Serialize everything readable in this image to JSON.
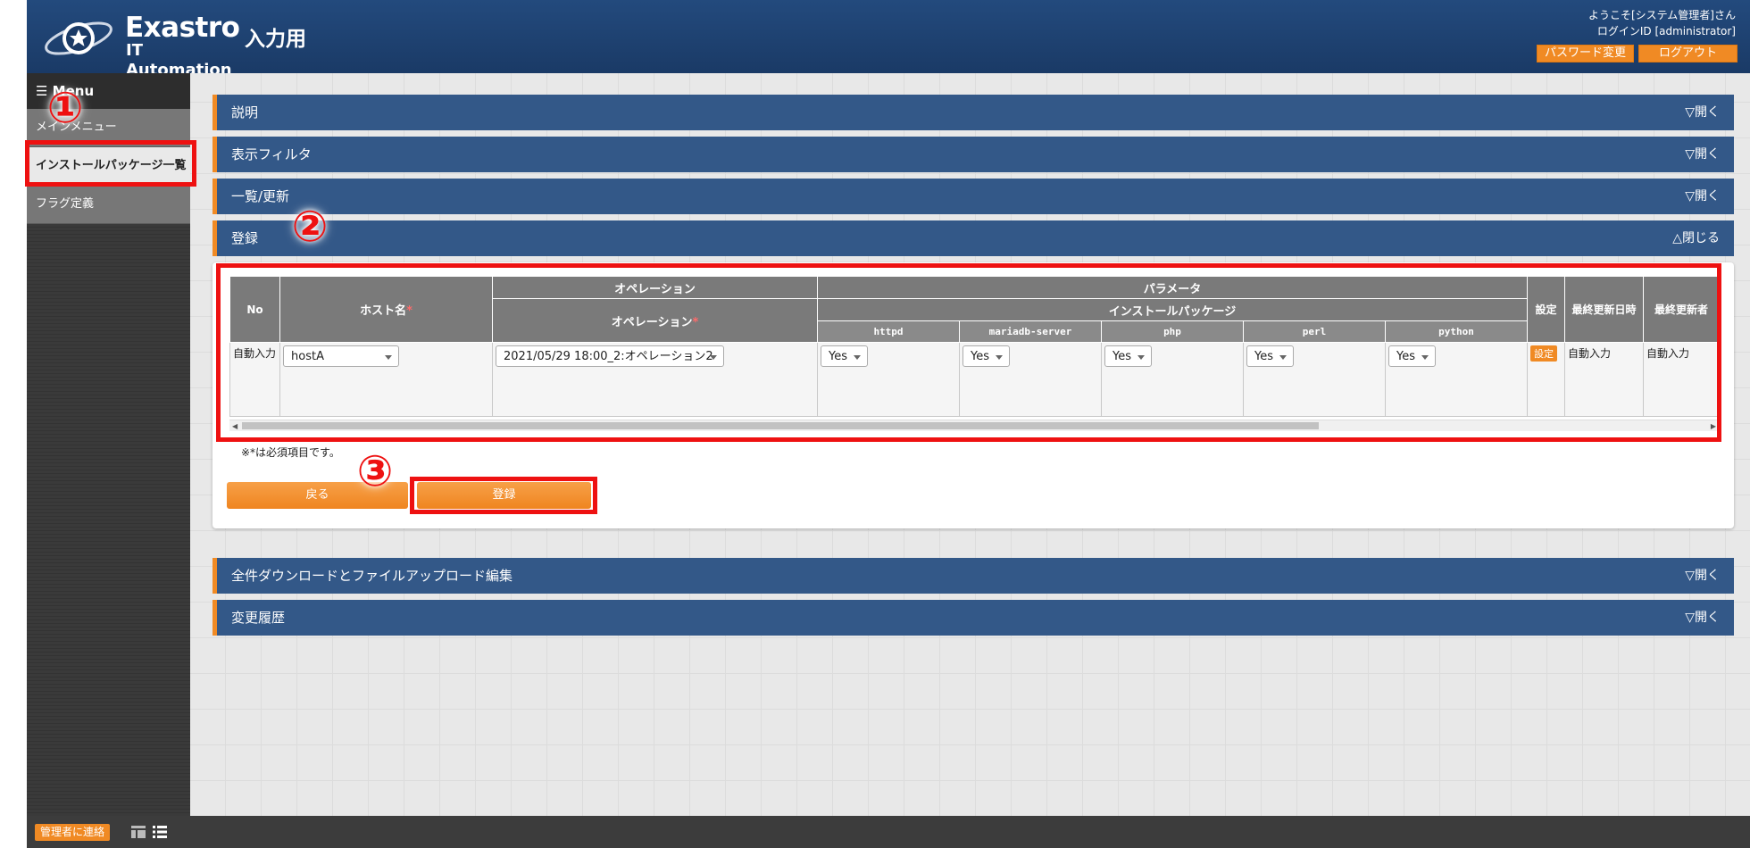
{
  "header": {
    "logo_line1": "Exastro",
    "logo_line2": "IT Automation",
    "page_title": "入力用",
    "welcome": "ようこそ[システム管理者]さん",
    "login_id": "ログインID [administrator]",
    "password_change": "パスワード変更",
    "logout": "ログアウト"
  },
  "sidebar": {
    "menu_title": "☰ Menu",
    "items": [
      {
        "label": "メインメニュー"
      },
      {
        "label": "インストールパッケージ一覧"
      },
      {
        "label": "フラグ定義"
      }
    ]
  },
  "sections": {
    "description": {
      "label": "説明",
      "toggle": "▽開く"
    },
    "filter": {
      "label": "表示フィルタ",
      "toggle": "▽開く"
    },
    "list": {
      "label": "一覧/更新",
      "toggle": "▽開く"
    },
    "register": {
      "label": "登録",
      "toggle": "△閉じる"
    },
    "download": {
      "label": "全件ダウンロードとファイルアップロード編集",
      "toggle": "▽開く"
    },
    "history": {
      "label": "変更履歴",
      "toggle": "▽開く"
    }
  },
  "table": {
    "col_no": "No",
    "col_host": "ホスト名",
    "group_operation": "オペレーション",
    "col_operation": "オペレーション",
    "group_parameter": "パラメータ",
    "group_install": "インストールパッケージ",
    "packages": [
      "httpd",
      "mariadb-server",
      "php",
      "perl",
      "python"
    ],
    "col_setting": "設定",
    "col_last_updated": "最終更新日時",
    "col_last_updater": "最終更新者",
    "required_mark": "*",
    "row": {
      "no": "自動入力",
      "host": "hostA",
      "operation": "2021/05/29 18:00_2:オペレーション2",
      "package_values": [
        "Yes",
        "Yes",
        "Yes",
        "Yes",
        "Yes"
      ],
      "setting_button": "設定",
      "last_updated": "自動入力",
      "last_updater": "自動入力"
    }
  },
  "required_note": "※*は必須項目です。",
  "buttons": {
    "back": "戻る",
    "register": "登録"
  },
  "footer": {
    "contact": "管理者に連絡"
  },
  "annotations": {
    "step1": "①",
    "step2": "②",
    "step3": "③"
  },
  "colors": {
    "accent": "#f08a24",
    "header": "#234a7d",
    "section_bar": "#335888",
    "annotation": "#ee1111"
  }
}
